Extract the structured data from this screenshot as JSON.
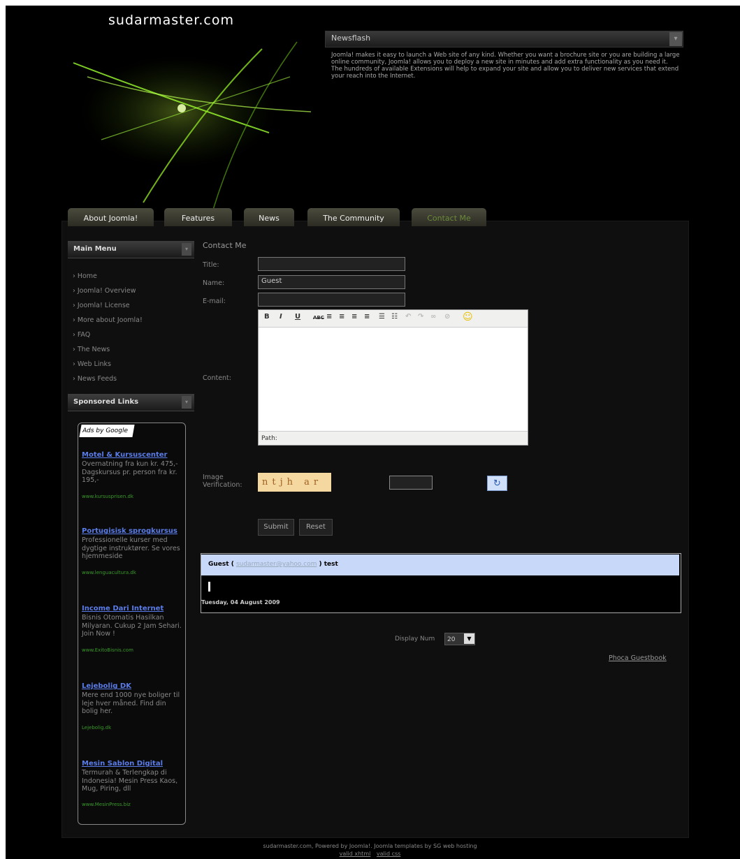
{
  "site": {
    "title": "sudarmaster.com"
  },
  "newsflash": {
    "title": "Newsflash",
    "text": "Joomla! makes it easy to launch a Web site of any kind. Whether you want a brochure site or you are building a large online community, Joomla! allows you to deploy a new site in minutes and add extra functionality as you need it. The hundreds of available Extensions will help to expand your site and allow you to deliver new services that extend your reach into the Internet."
  },
  "tabs": [
    "About Joomla!",
    "Features",
    "News",
    "The Community",
    "Contact Me"
  ],
  "main_menu": {
    "title": "Main Menu",
    "items": [
      "Home",
      "Joomla! Overview",
      "Joomla! License",
      "More about Joomla!",
      "FAQ",
      "The News",
      "Web Links",
      "News Feeds"
    ]
  },
  "sponsored": {
    "title": "Sponsored Links",
    "ads_by": "Ads by Google",
    "ads": [
      {
        "title": "Motel & Kursuscenter",
        "text": "Overnatning fra kun kr. 475,- Dagskursus pr. person fra kr. 195,-",
        "url": "www.kursusprisen.dk"
      },
      {
        "title": "Portugisisk sprogkursus",
        "text": "Professionelle kurser med dygtige instruktører. Se vores hjemmeside",
        "url": "www.lenguacultura.dk"
      },
      {
        "title": "Income Dari Internet",
        "text": "Bisnis Otomatis Hasilkan Milyaran. Cukup 2 Jam Sehari. Join Now !",
        "url": "www.ExitoBisnis.com"
      },
      {
        "title": "Lejebolig DK",
        "text": "Mere end 1000 nye boliger til leje hver måned. Find din bolig her.",
        "url": "Lejebolig.dk"
      },
      {
        "title": "Mesin Sablon Digital",
        "text": "Termurah & Terlengkap di Indonesia! Mesin Press Kaos, Mug, Piring, dll",
        "url": "www.MesinPress.biz"
      }
    ]
  },
  "contact": {
    "heading": "Contact Me",
    "labels": {
      "title": "Title:",
      "name": "Name:",
      "email": "E-mail:",
      "content": "Content:",
      "image": "Image Verification:"
    },
    "values": {
      "title": "",
      "name": "Guest",
      "email": ""
    },
    "editor_path": "Path:",
    "captcha_text": "ntjh ar",
    "submit": "Submit",
    "reset": "Reset"
  },
  "guestbook": {
    "author": "Guest (",
    "email": "sudarmaster@yahoo.com",
    "subject": ") test",
    "date": "Tuesday, 04 August 2009",
    "display_num_label": "Display Num",
    "display_num_value": "20",
    "phoca_link": "Phoca Guestbook"
  },
  "footer": {
    "text": "sudarmaster.com, Powered by Joomla!. Joomla templates by SG web hosting",
    "links": [
      "valid xhtml",
      "valid css"
    ]
  }
}
